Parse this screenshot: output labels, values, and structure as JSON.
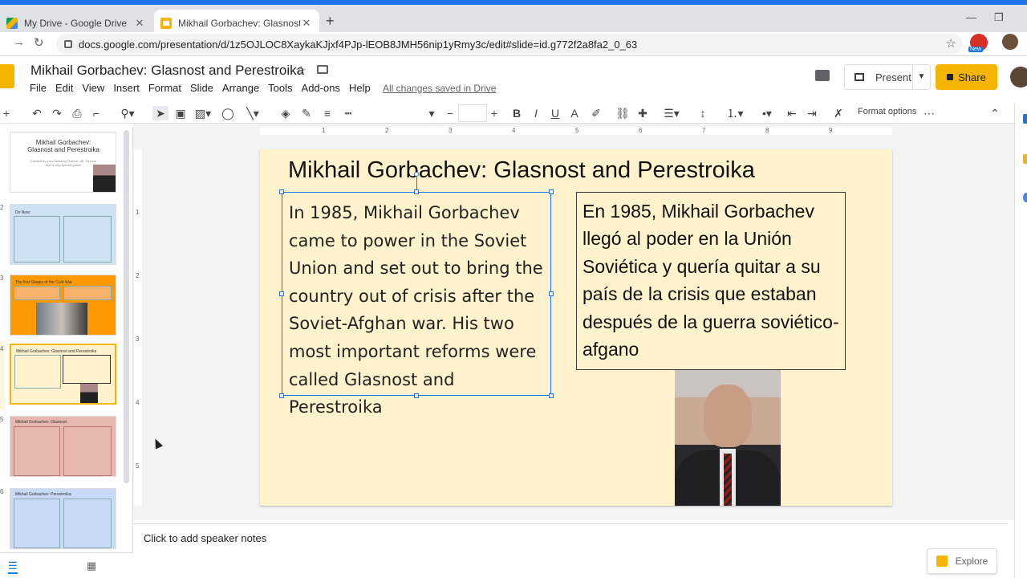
{
  "browser": {
    "tabs": [
      {
        "label": "My Drive - Google Drive",
        "active": false
      },
      {
        "label": "Mikhail Gorbachev: Glasnost and",
        "active": true
      }
    ],
    "url": "docs.google.com/presentation/d/1z5OJLOC8XaykaKJjxf4PJp-lEOB8JMH56nip1yRmy3c/edit#slide=id.g772f2a8fa2_0_63",
    "extension_badge": "New"
  },
  "app": {
    "doc_title": "Mikhail Gorbachev: Glasnost and Perestroika",
    "menus": [
      "File",
      "Edit",
      "View",
      "Insert",
      "Format",
      "Slide",
      "Arrange",
      "Tools",
      "Add-ons",
      "Help"
    ],
    "save_status": "All changes saved in Drive",
    "present_label": "Present",
    "share_label": "Share"
  },
  "toolbar": {
    "format_options_label": "Format options",
    "bold": "B",
    "italic": "I",
    "underline": "U",
    "text_color": "A"
  },
  "filmstrip": {
    "numbers": [
      "2",
      "3",
      "4",
      "5",
      "6"
    ],
    "slide1": {
      "title": "Mikhail Gorbachev:\nGlasnost and Perestroika",
      "sub": "Created by your Amazing Teacher, Mr. Herrera\nAnd a very special guest!"
    },
    "slide2": {
      "heading": "Do Now:"
    },
    "slide3": {
      "heading": "The first Stages of the Cold War"
    },
    "slide4": {
      "heading": "Mikhail Gorbachev: Glasnost and Perestroika"
    },
    "slide5": {
      "heading": "Mikhail Gorbachev: Glasnost"
    },
    "slide6": {
      "heading": "Mikhail Gorbachev: Perestroika"
    }
  },
  "ruler": {
    "top": [
      "1",
      "2",
      "3",
      "4",
      "5",
      "6",
      "7",
      "8",
      "9"
    ],
    "left": [
      "1",
      "2",
      "3",
      "4",
      "5"
    ]
  },
  "slide": {
    "title": "Mikhail Gorbachev: Glasnost and Perestroika",
    "english_text": "In 1985, Mikhail Gorbachev came to power in the Soviet Union and set out to bring the country out of crisis after the Soviet-Afghan war. His two most important reforms were called Glasnost and Perestroika",
    "spanish_text": "En 1985, Mikhail Gorbachev llegó al poder en la Unión Soviética y quería quitar a su país de la crisis que estaban después de la guerra soviético-afgano",
    "background_color": "#fff2cc"
  },
  "notes": {
    "placeholder": "Click to add speaker notes"
  },
  "explore": {
    "label": "Explore"
  },
  "colors": {
    "accent": "#1a73e8",
    "slides_yellow": "#f4b400"
  }
}
